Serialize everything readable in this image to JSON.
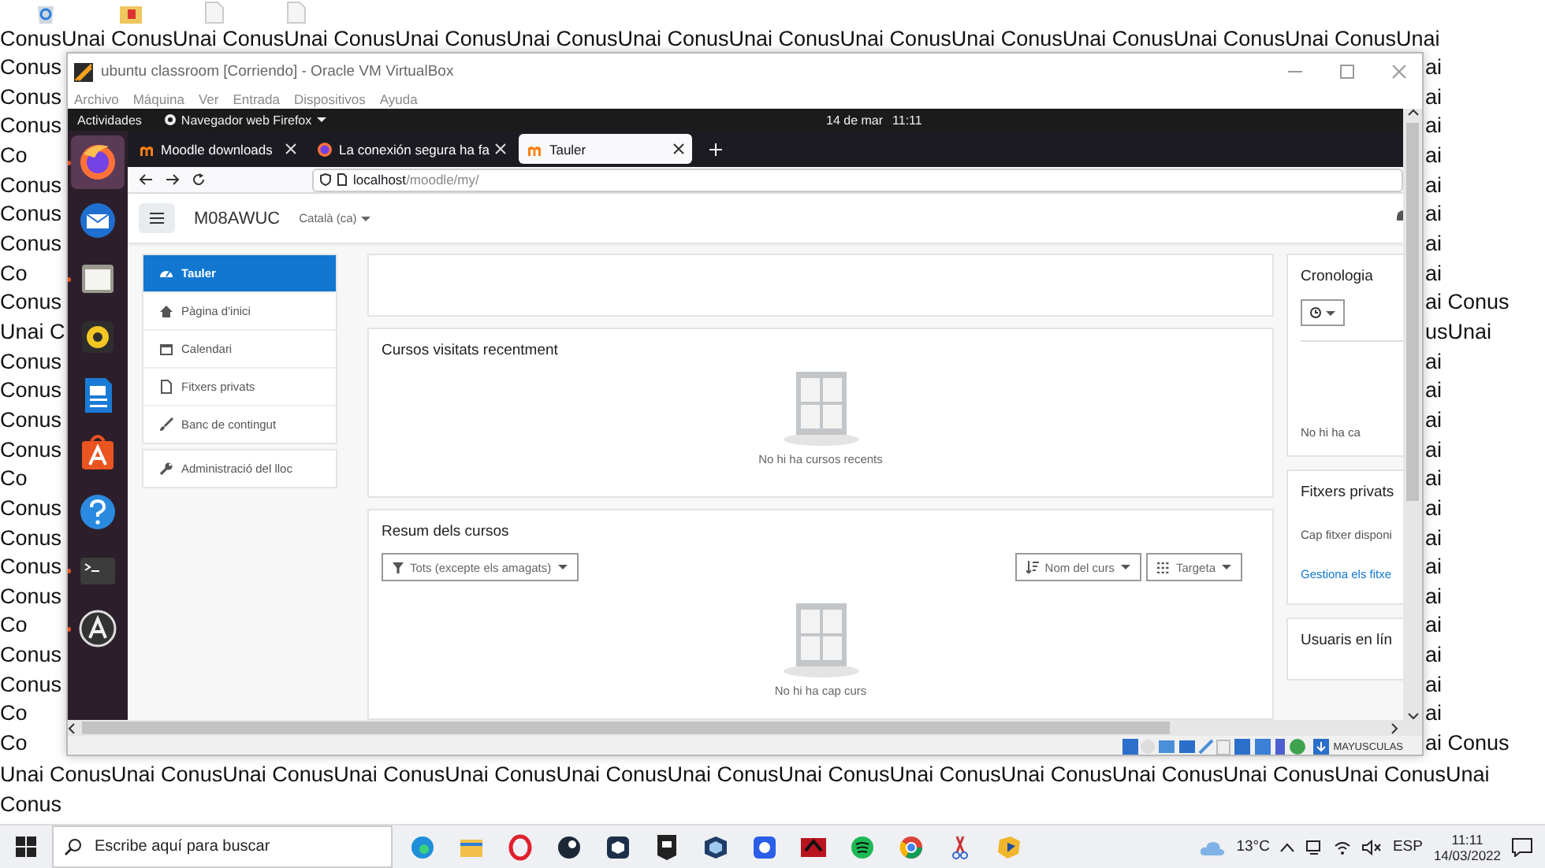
{
  "desktop": {
    "wallpaper_top": "ConusUnai ConusUnai ConusUnai ConusUnai ConusUnai ConusUnai ConusUnai ConusUnai ConusUnai ConusUnai ConusUnai ConusUnai ConusUnai",
    "wallpaper_left": [
      "Conus",
      "Conus",
      "Conus",
      "Co",
      "Conus",
      "Conus",
      "Conus",
      "Co",
      "Conus",
      "Unai C",
      "Conus",
      "Conus",
      "Conus",
      "Conus",
      "Co",
      "Conus",
      "Conus",
      "Conus",
      "Conus",
      "Co",
      "Conus",
      "Conus",
      "Co",
      "Co"
    ],
    "wallpaper_right": [
      "ai",
      "ai",
      "ai",
      "ai",
      "ai",
      "ai",
      "ai",
      "ai",
      "ai Conus",
      "usUnai",
      "ai",
      "ai",
      "ai",
      "ai",
      "ai",
      "ai",
      "ai",
      "ai",
      "ai",
      "ai",
      "ai",
      "ai",
      "ai",
      "ai Conus"
    ],
    "wallpaper_bottom": [
      "Unai ConusUnai ConusUnai ConusUnai ConusUnai ConusUnai ConusUnai ConusUnai ConusUnai ConusUnai ConusUnai ConusUnai ConusUnai ConusUnai",
      "Conus"
    ]
  },
  "window": {
    "title": "ubuntu classroom [Corriendo] - Oracle VM VirtualBox",
    "menu": [
      "Archivo",
      "Máquina",
      "Ver",
      "Entrada",
      "Dispositivos",
      "Ayuda"
    ],
    "status_text": "MAYUSCULAS"
  },
  "ubuntu": {
    "activities": "Actividades",
    "app_menu": "Navegador web Firefox",
    "date": "14 de mar",
    "time": "11:11",
    "dock": [
      {
        "kind": "firefox",
        "selected": true,
        "running": true
      },
      {
        "kind": "mail",
        "selected": false,
        "running": false
      },
      {
        "kind": "files",
        "selected": false,
        "running": true
      },
      {
        "kind": "music",
        "selected": false,
        "running": false
      },
      {
        "kind": "writer",
        "selected": false,
        "running": false
      },
      {
        "kind": "software",
        "selected": false,
        "running": false
      },
      {
        "kind": "help",
        "selected": false,
        "running": false
      },
      {
        "kind": "terminal",
        "selected": false,
        "running": true
      },
      {
        "kind": "updater",
        "selected": false,
        "running": true
      }
    ]
  },
  "browser": {
    "tabs": [
      {
        "label": "Moodle downloads",
        "kind": "moodle",
        "selected": false
      },
      {
        "label": "La conexión segura ha fa",
        "kind": "warning",
        "selected": false
      },
      {
        "label": "Tauler",
        "kind": "moodle",
        "selected": true
      }
    ],
    "url": "**localhost**/moodle/my/"
  },
  "moodle": {
    "site_name": "M08AWUC",
    "language": "Català (ca)",
    "nav": [
      {
        "label": "Tauler",
        "kind": "dashboard",
        "selected": true
      },
      {
        "label": "Pàgina d'inici",
        "kind": "home",
        "selected": false
      },
      {
        "label": "Calendari",
        "kind": "calendar",
        "selected": false
      },
      {
        "label": "Fitxers privats",
        "kind": "file",
        "selected": false
      },
      {
        "label": "Banc de contingut",
        "kind": "brush",
        "selected": false
      }
    ],
    "admin_nav": [
      {
        "label": "Administració del lloc",
        "kind": "wrench",
        "selected": false
      }
    ],
    "recent": {
      "title": "Cursos visitats recentment",
      "empty": "No hi ha cursos recents"
    },
    "overview": {
      "title": "Resum dels cursos",
      "filter": "Tots (excepte els amagats)",
      "sort": "Nom del curs",
      "view": "Targeta",
      "empty": "No hi ha cap curs"
    },
    "timeline": {
      "title": "Cronologia",
      "empty": "No hi ha ca"
    },
    "private_files": {
      "title": "Fitxers privats",
      "empty": "Cap fitxer disponi",
      "link": "Gestiona els fitxe"
    },
    "online_users": {
      "title": "Usuaris en lín"
    }
  },
  "taskbar": {
    "search_placeholder": "Escribe aquí para buscar",
    "weather": "13°C",
    "language": "ESP",
    "time": "11:11",
    "date": "14/03/2022"
  }
}
